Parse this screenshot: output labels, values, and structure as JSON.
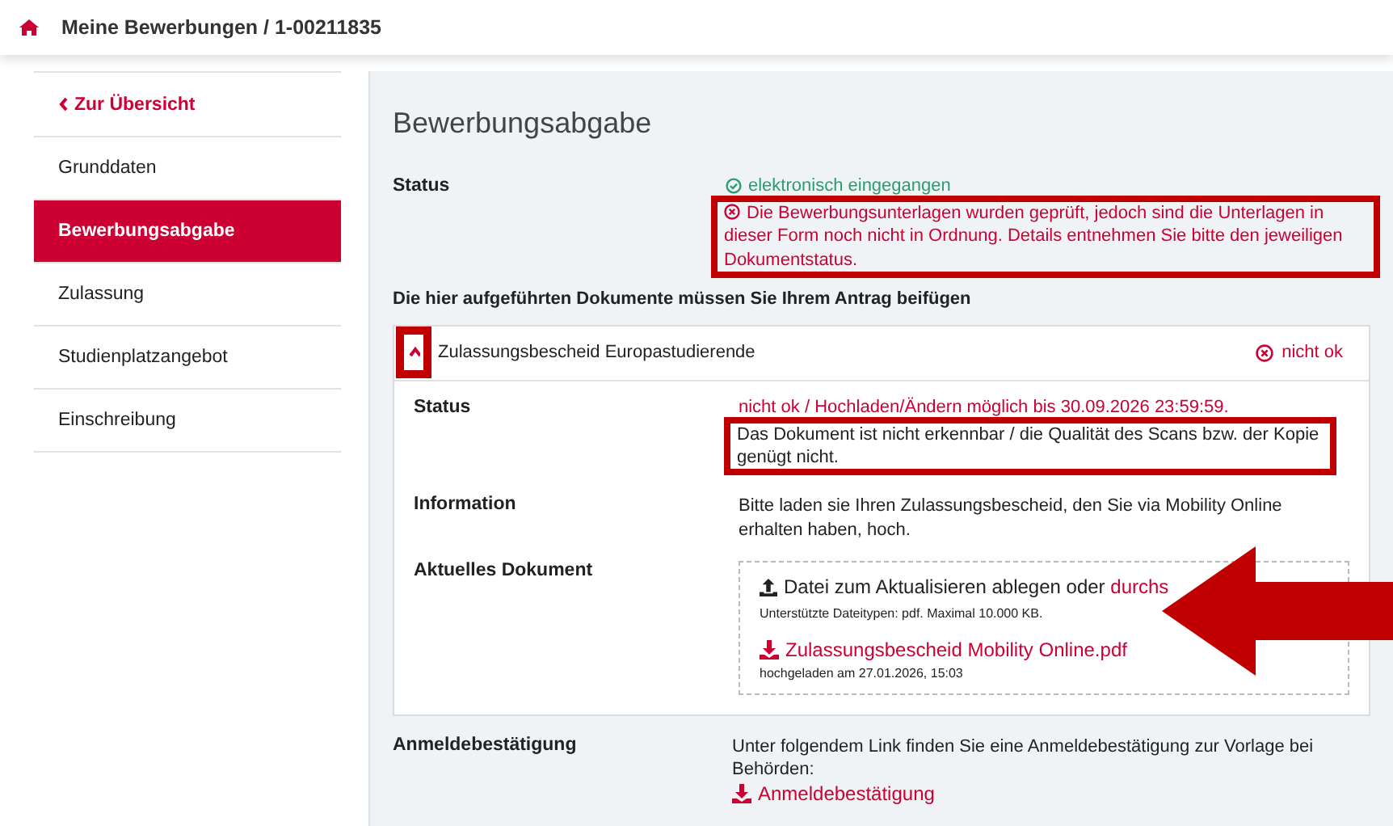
{
  "header": {
    "breadcrumb": "Meine Bewerbungen / 1-00211835"
  },
  "sidebar": {
    "back_link": "Zur Übersicht",
    "items": [
      {
        "label": "Grunddaten",
        "selected": false
      },
      {
        "label": "Bewerbungsabgabe",
        "selected": true
      },
      {
        "label": "Zulassung",
        "selected": false
      },
      {
        "label": "Studienplatzangebot",
        "selected": false
      },
      {
        "label": "Einschreibung",
        "selected": false
      }
    ]
  },
  "main": {
    "title": "Bewerbungsabgabe",
    "status": {
      "label": "Status",
      "received": "elektronisch eingegangen",
      "message": "Die Bewerbungsunterlagen wurden geprüft, jedoch sind die Unterlagen in dieser Form noch nicht in Ordnung. Details entnehmen Sie bitte den jeweiligen Dokumentstatus.",
      "highlighted": true
    },
    "documents_heading": "Die hier aufgeführten Dokumente müssen Sie Ihrem Antrag beifügen",
    "documents": [
      {
        "title": "Zulassungsbescheid Europastudierende",
        "expanded": true,
        "toggle_highlighted": true,
        "badge": "nicht ok",
        "status_label": "Status",
        "status_text": "nicht ok / Hochladen/Ändern möglich bis 30.09.2026 23:59:59.",
        "reason": "Das Dokument ist nicht erkennbar / die Qualität des Scans bzw. der Kopie genügt nicht.",
        "reason_highlighted": true,
        "info_label": "Information",
        "info_text": "Bitte laden sie Ihren Zulassungsbescheid, den Sie via Mobility Online erhalten haben, hoch.",
        "current_label": "Aktuelles Dokument",
        "upload": {
          "prompt": "Datei zum Aktualisieren ablegen oder",
          "browse_link": "durchs",
          "hint": "Unterstützte Dateitypen: pdf. Maximal 10.000 KB.",
          "arrow_pointer": true
        },
        "file": {
          "name": "Zulassungsbescheid Mobility Online.pdf",
          "uploaded": "hochgeladen am 27.01.2026, 15:03"
        }
      }
    ],
    "registration": {
      "label": "Anmeldebestätigung",
      "text": "Unter folgendem Link finden Sie eine Anmeldebestätigung zur Vorlage bei Behörden:",
      "link": "Anmeldebestätigung"
    }
  }
}
